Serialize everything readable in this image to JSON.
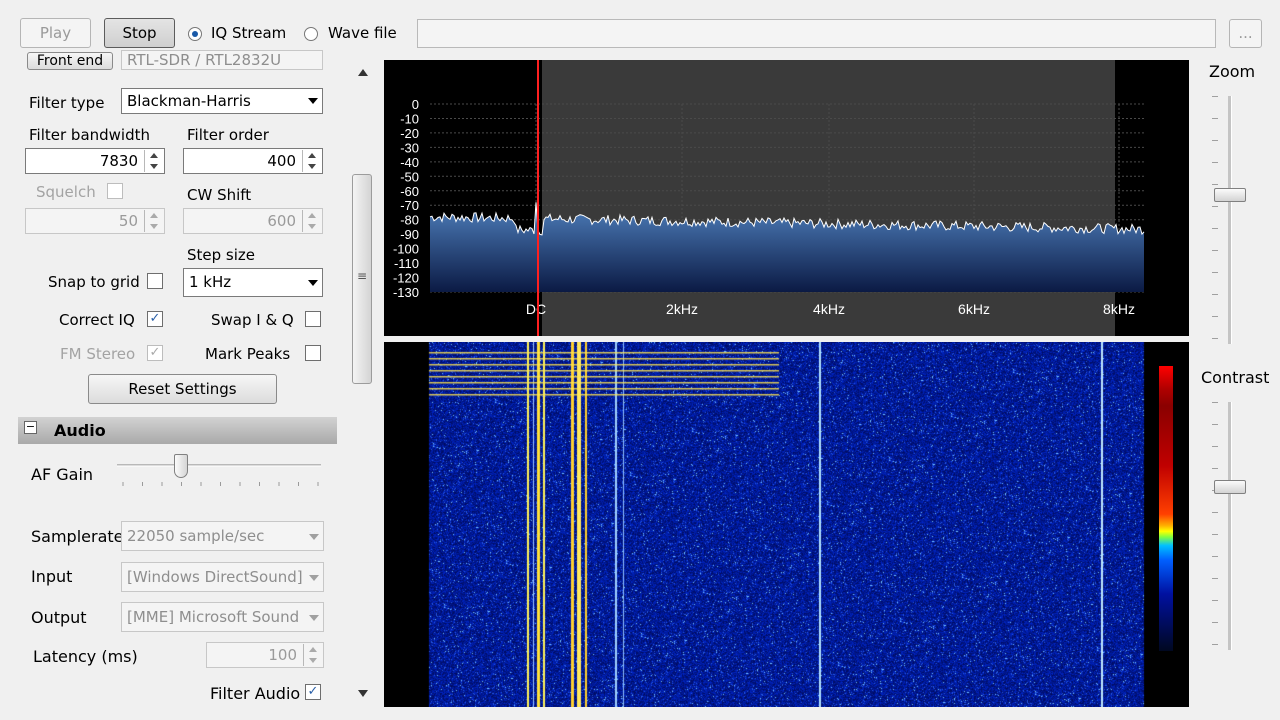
{
  "toolbar": {
    "play": "Play",
    "stop": "Stop",
    "iq_stream": "IQ Stream",
    "wave_file": "Wave file",
    "file_path": "",
    "browse": "..."
  },
  "radio": {
    "front_end_button": "Front end",
    "front_end_device": "RTL-SDR / RTL2832U",
    "filter_type_label": "Filter type",
    "filter_type": "Blackman-Harris",
    "filter_bandwidth_label": "Filter bandwidth",
    "filter_bandwidth": "7830",
    "filter_order_label": "Filter order",
    "filter_order": "400",
    "squelch_label": "Squelch",
    "squelch_value": "50",
    "cw_shift_label": "CW Shift",
    "cw_shift": "600",
    "step_size_label": "Step size",
    "step_size": "1 kHz",
    "snap_to_grid": "Snap to grid",
    "correct_iq": "Correct IQ",
    "swap_iq": "Swap I & Q",
    "fm_stereo": "FM Stereo",
    "mark_peaks": "Mark Peaks",
    "check_mark": "✓",
    "reset_settings": "Reset Settings"
  },
  "audio": {
    "header": "Audio",
    "collapse_glyph": "−",
    "af_gain_label": "AF Gain",
    "af_gain_fraction": 0.3,
    "samplerate_label": "Samplerate",
    "samplerate": "22050 sample/sec",
    "input_label": "Input",
    "input": "[Windows DirectSound]",
    "output_label": "Output",
    "output": "[MME] Microsoft Sound",
    "latency_label": "Latency (ms)",
    "latency": "100",
    "filter_audio": "Filter Audio"
  },
  "spectrum": {
    "db_ticks": [
      "0",
      "-10",
      "-20",
      "-30",
      "-40",
      "-50",
      "-60",
      "-70",
      "-80",
      "-90",
      "-100",
      "-110",
      "-120",
      "-130"
    ],
    "freq_ticks": [
      "DC",
      "2kHz",
      "4kHz",
      "6kHz",
      "8kHz"
    ],
    "colors": {
      "trace": "#ffffff",
      "fill_top": "#4f80bd",
      "fill_bottom": "#0b1a44",
      "marker": "#ff2020",
      "filter_band": "#3a3a3a"
    }
  },
  "right_panel": {
    "zoom_label": "Zoom",
    "contrast_label": "Contrast",
    "zoom_level": 0.4,
    "contrast_level": 0.34
  },
  "scrollbar": {
    "grip": "≡"
  }
}
